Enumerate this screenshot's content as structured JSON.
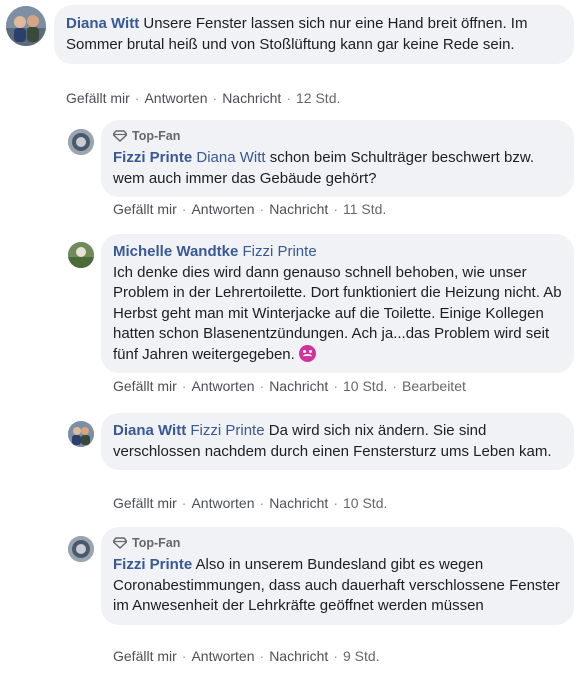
{
  "actions": {
    "like": "Gefällt mir",
    "reply": "Antworten",
    "message": "Nachricht",
    "edited": "Bearbeitet"
  },
  "badge": {
    "top_fan": "Top-Fan"
  },
  "comments": [
    {
      "author": "Diana Witt",
      "text": "Unsere Fenster lassen sich nur eine Hand breit öffnen. Im Sommer brutal heiß und von Stoßlüftung kann gar keine Rede sein.",
      "time": "12 Std."
    },
    {
      "author": "Fizzi Printe",
      "mention": "Diana Witt",
      "text": "schon beim Schulträger beschwert bzw. wem auch immer das Gebäude gehört?",
      "time": "11 Std."
    },
    {
      "author": "Michelle Wandtke",
      "mention": "Fizzi Printe",
      "text": "Ich denke dies wird dann genauso schnell behoben, wie unser Problem in der Lehrertoilette. Dort funktioniert die Heizung nicht. Ab Herbst geht man mit Winterjacke auf die Toilette. Einige Kollegen hatten schon Blasenentzündungen. Ach ja...das Problem wird seit fünf Jahren weitergegeben.",
      "time": "10 Std."
    },
    {
      "author": "Diana Witt",
      "mention": "Fizzi Printe",
      "text": "Da wird sich nix ändern. Sie sind verschlossen nachdem durch einen Fenstersturz ums Leben kam.",
      "time": "10 Std."
    },
    {
      "author": "Fizzi Printe",
      "text": "Also in unserem Bundesland gibt es wegen Coronabestimmungen, dass auch dauerhaft verschlossene Fenster im Anwesenheit der Lehrkräfte geöffnet werden müssen",
      "time": "9 Std."
    }
  ],
  "colors": {
    "link": "#385898",
    "bubble": "#f0f2f5",
    "meta": "#65676b"
  }
}
